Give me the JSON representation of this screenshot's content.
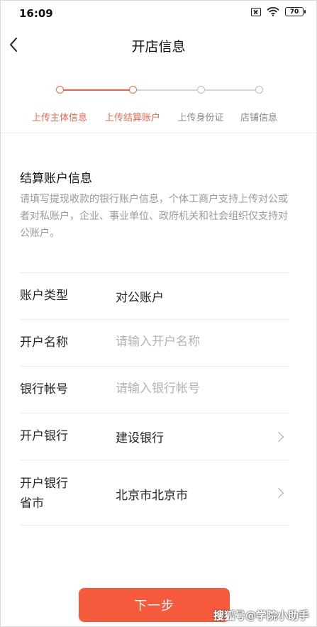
{
  "status_bar": {
    "time": "16:09",
    "battery": "70"
  },
  "nav": {
    "title": "开店信息",
    "back_icon": "chevron-left-icon"
  },
  "stepper": {
    "steps": [
      {
        "label": "上传主体信息",
        "state": "done"
      },
      {
        "label": "上传结算账户",
        "state": "active"
      },
      {
        "label": "上传身份证",
        "state": "pending"
      },
      {
        "label": "店铺信息",
        "state": "pending"
      }
    ],
    "active_color": "#f0654a",
    "inactive_color": "#bbbbbb"
  },
  "section": {
    "title": "结算账户信息",
    "description": "请填写提现收款的银行账户信息，个体工商户支持上传对公或者对私账户，企业、事业单位、政府机关和社会组织仅支持对公账户。"
  },
  "form": {
    "account_type": {
      "label": "账户类型",
      "value": "对公账户"
    },
    "account_name": {
      "label": "开户名称",
      "placeholder": "请输入开户名称",
      "value": ""
    },
    "account_number": {
      "label": "银行帐号",
      "placeholder": "请输入银行帐号",
      "value": ""
    },
    "bank": {
      "label": "开户银行",
      "value": "建设银行"
    },
    "bank_region": {
      "label_line1": "开户银行",
      "label_line2": "省市",
      "value": "北京市北京市"
    }
  },
  "next_button": {
    "label": "下一步",
    "color": "#f65a3c"
  },
  "watermark": "搜狐号@学院小助手"
}
